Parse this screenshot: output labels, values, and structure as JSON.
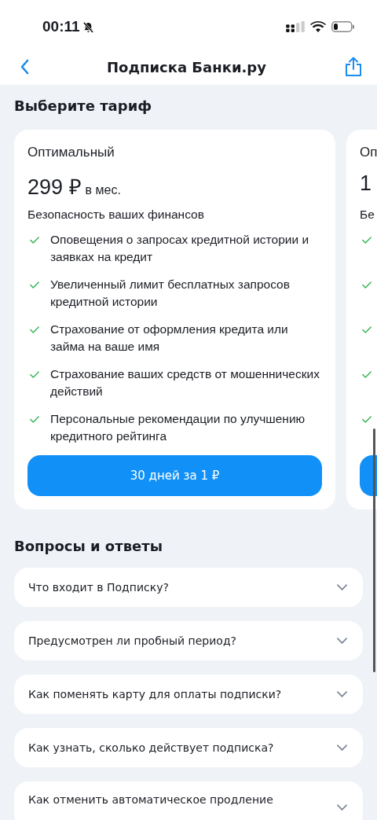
{
  "status_bar": {
    "time": "00:11",
    "silent": true
  },
  "nav": {
    "title": "Подписка Банки.ру"
  },
  "tariffs_heading": "Выберите тариф",
  "tariffs": [
    {
      "title": "Оптимальный",
      "price": "299 ₽",
      "period": "в мес.",
      "section": "Безопасность ваших финансов",
      "features": [
        {
          "kind": "check",
          "text": "Оповещения о запросах кредитной истории и заявках на кредит"
        },
        {
          "kind": "check",
          "text": "Увеличенный лимит бесплатных запросов кредитной истории"
        },
        {
          "kind": "check",
          "text": "Страхование от оформления кредита или займа на ваше имя"
        },
        {
          "kind": "check",
          "text": "Страхование ваших средств от мошеннических действий"
        },
        {
          "kind": "check",
          "text": "Персональные рекомендации по улучшению кредитного рейтинга"
        }
      ],
      "button": {
        "kind": "primary",
        "label": "30 дней за 1 ₽"
      }
    },
    {
      "title": "Оп",
      "price": "1",
      "section": "Бе",
      "features": [
        {
          "kind": "check"
        },
        {
          "kind": "check"
        },
        {
          "kind": "check"
        },
        {
          "kind": "check"
        },
        {
          "kind": "check"
        }
      ],
      "button": {
        "kind": "primary"
      }
    }
  ],
  "faq_heading": "Вопросы и ответы",
  "faq": [
    {
      "question": "Что входит в Подписку?",
      "expanded": false
    },
    {
      "question": "Предусмотрен ли пробный период?",
      "expanded": false
    },
    {
      "question": "Как поменять карту для оплаты подписки?",
      "expanded": false
    },
    {
      "question": "Как узнать, сколько действует подписка?",
      "expanded": false
    },
    {
      "question": "Как отменить автоматическое продление",
      "expanded": false
    }
  ]
}
